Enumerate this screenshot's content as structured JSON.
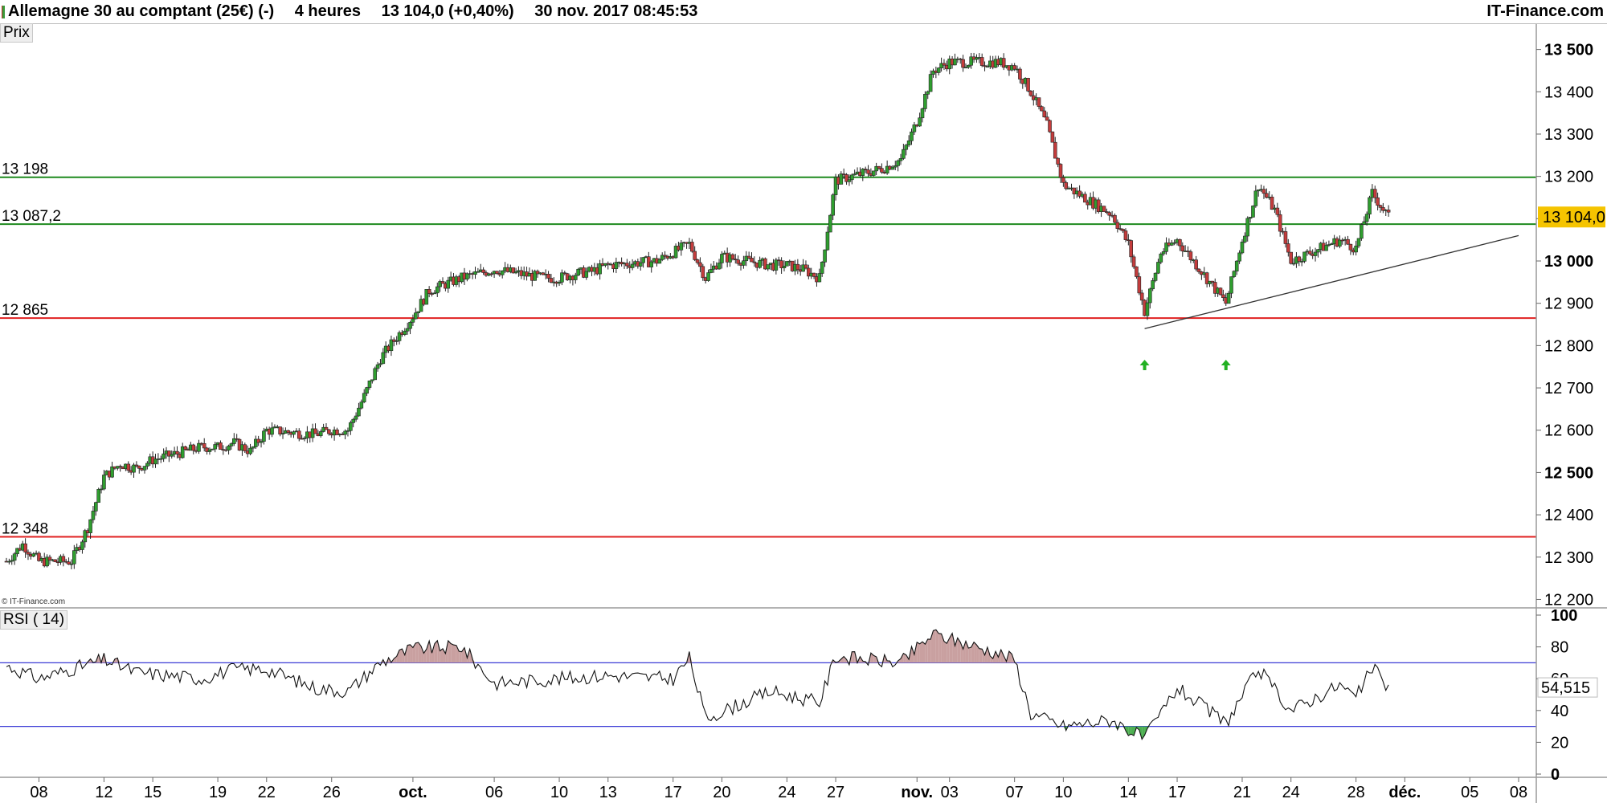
{
  "header": {
    "instrument": "Allemagne 30 au comptant (25€) (-)",
    "timeframe": "4 heures",
    "last_price_change": "13 104,0 (+0,40%)",
    "datetime": "30 nov. 2017 08:45:53",
    "brand": "IT-Finance.com"
  },
  "price_panel": {
    "label": "Prix",
    "copyright": "© IT-Finance.com"
  },
  "rsi_panel": {
    "label": "RSI ( 14)"
  },
  "colors": {
    "up_candle": "#2f9e2f",
    "down_candle": "#c43c3c",
    "resistance_line": "#1e8a1e",
    "support_line": "#e02020",
    "rsi_band": "#3b3bd6",
    "rsi_fill": "#c9a0a0",
    "price_badge": "#f5c400",
    "signal_arrow": "#22b022"
  },
  "chart_data": [
    {
      "type": "candlestick",
      "title": "Allemagne 30 au comptant (25€) (-)",
      "timeframe": "4 heures",
      "y_ticks": [
        "12 200",
        "12 300",
        "12 400",
        "12 500",
        "12 600",
        "12 700",
        "12 800",
        "12 900",
        "13 000",
        "13 100",
        "13 200",
        "13 300",
        "13 400",
        "13 500"
      ],
      "ylim": [
        12180,
        13560
      ],
      "x_tick_labels": [
        "08",
        "12",
        "15",
        "19",
        "22",
        "26",
        "oct.",
        "06",
        "10",
        "13",
        "17",
        "20",
        "24",
        "27",
        "nov.",
        "03",
        "07",
        "10",
        "14",
        "17",
        "21",
        "24",
        "28",
        "déc.",
        "05",
        "08"
      ],
      "last_price": "13 104,0",
      "horizontal_levels": [
        {
          "label": "13 198",
          "value": 13198,
          "kind": "resistance"
        },
        {
          "label": "13 087,2",
          "value": 13087.2,
          "kind": "resistance"
        },
        {
          "label": "12 865",
          "value": 12865,
          "kind": "support"
        },
        {
          "label": "12 348",
          "value": 12348,
          "kind": "support"
        }
      ],
      "trendline": {
        "from": {
          "date": "2017-11-15",
          "value": 12840
        },
        "to": {
          "date": "2017-12-08",
          "value": 13060
        }
      },
      "signal_arrows": [
        {
          "date": "2017-11-15",
          "direction": "up"
        },
        {
          "date": "2017-11-20",
          "direction": "up"
        }
      ],
      "close_path": [
        {
          "x": "2017-09-06",
          "y": 12290
        },
        {
          "x": "2017-09-07",
          "y": 12330
        },
        {
          "x": "2017-09-08",
          "y": 12290
        },
        {
          "x": "2017-09-10",
          "y": 12290
        },
        {
          "x": "2017-09-11",
          "y": 12370
        },
        {
          "x": "2017-09-12",
          "y": 12490
        },
        {
          "x": "2017-09-13",
          "y": 12520
        },
        {
          "x": "2017-09-14",
          "y": 12510
        },
        {
          "x": "2017-09-15",
          "y": 12530
        },
        {
          "x": "2017-09-18",
          "y": 12560
        },
        {
          "x": "2017-09-19",
          "y": 12560
        },
        {
          "x": "2017-09-20",
          "y": 12570
        },
        {
          "x": "2017-09-21",
          "y": 12550
        },
        {
          "x": "2017-09-22",
          "y": 12600
        },
        {
          "x": "2017-09-25",
          "y": 12590
        },
        {
          "x": "2017-09-26",
          "y": 12600
        },
        {
          "x": "2017-09-27",
          "y": 12600
        },
        {
          "x": "2017-09-28",
          "y": 12680
        },
        {
          "x": "2017-09-29",
          "y": 12770
        },
        {
          "x": "2017-10-01",
          "y": 12870
        },
        {
          "x": "2017-10-02",
          "y": 12930
        },
        {
          "x": "2017-10-04",
          "y": 12960
        },
        {
          "x": "2017-10-06",
          "y": 12980
        },
        {
          "x": "2017-10-09",
          "y": 12960
        },
        {
          "x": "2017-10-10",
          "y": 12960
        },
        {
          "x": "2017-10-11",
          "y": 12970
        },
        {
          "x": "2017-10-12",
          "y": 12975
        },
        {
          "x": "2017-10-13",
          "y": 12990
        },
        {
          "x": "2017-10-16",
          "y": 13000
        },
        {
          "x": "2017-10-17",
          "y": 13020
        },
        {
          "x": "2017-10-18",
          "y": 13040
        },
        {
          "x": "2017-10-19",
          "y": 12960
        },
        {
          "x": "2017-10-20",
          "y": 13010
        },
        {
          "x": "2017-10-23",
          "y": 12990
        },
        {
          "x": "2017-10-24",
          "y": 12990
        },
        {
          "x": "2017-10-25",
          "y": 12980
        },
        {
          "x": "2017-10-26",
          "y": 12960
        },
        {
          "x": "2017-10-27",
          "y": 13190
        },
        {
          "x": "2017-10-30",
          "y": 13220
        },
        {
          "x": "2017-10-31",
          "y": 13240
        },
        {
          "x": "2017-11-01",
          "y": 13330
        },
        {
          "x": "2017-11-02",
          "y": 13450
        },
        {
          "x": "2017-11-03",
          "y": 13470
        },
        {
          "x": "2017-11-06",
          "y": 13470
        },
        {
          "x": "2017-11-07",
          "y": 13460
        },
        {
          "x": "2017-11-08",
          "y": 13400
        },
        {
          "x": "2017-11-09",
          "y": 13320
        },
        {
          "x": "2017-11-10",
          "y": 13180
        },
        {
          "x": "2017-11-13",
          "y": 13110
        },
        {
          "x": "2017-11-14",
          "y": 13040
        },
        {
          "x": "2017-11-15",
          "y": 12880
        },
        {
          "x": "2017-11-16",
          "y": 13020
        },
        {
          "x": "2017-11-17",
          "y": 13050
        },
        {
          "x": "2017-11-20",
          "y": 12900
        },
        {
          "x": "2017-11-21",
          "y": 13050
        },
        {
          "x": "2017-11-22",
          "y": 13180
        },
        {
          "x": "2017-11-23",
          "y": 13120
        },
        {
          "x": "2017-11-24",
          "y": 13000
        },
        {
          "x": "2017-11-27",
          "y": 13050
        },
        {
          "x": "2017-11-28",
          "y": 13030
        },
        {
          "x": "2017-11-29",
          "y": 13160
        },
        {
          "x": "2017-11-30",
          "y": 13104
        }
      ]
    },
    {
      "type": "line",
      "title": "RSI ( 14)",
      "y_ticks": [
        "0",
        "20",
        "40",
        "60",
        "80",
        "100"
      ],
      "ylim": [
        0,
        100
      ],
      "bands": [
        30,
        70
      ],
      "last_value": "54,515",
      "series": [
        {
          "values_by_date": [
            {
              "x": "2017-09-06",
              "y": 68
            },
            {
              "x": "2017-09-08",
              "y": 60
            },
            {
              "x": "2017-09-12",
              "y": 72
            },
            {
              "x": "2017-09-14",
              "y": 64
            },
            {
              "x": "2017-09-18",
              "y": 60
            },
            {
              "x": "2017-09-20",
              "y": 66
            },
            {
              "x": "2017-09-22",
              "y": 66
            },
            {
              "x": "2017-09-25",
              "y": 54
            },
            {
              "x": "2017-09-27",
              "y": 52
            },
            {
              "x": "2017-09-29",
              "y": 70
            },
            {
              "x": "2017-10-01",
              "y": 79
            },
            {
              "x": "2017-10-04",
              "y": 80
            },
            {
              "x": "2017-10-06",
              "y": 57
            },
            {
              "x": "2017-10-10",
              "y": 60
            },
            {
              "x": "2017-10-13",
              "y": 62
            },
            {
              "x": "2017-10-17",
              "y": 60
            },
            {
              "x": "2017-10-18",
              "y": 73
            },
            {
              "x": "2017-10-19",
              "y": 35
            },
            {
              "x": "2017-10-23",
              "y": 52
            },
            {
              "x": "2017-10-26",
              "y": 45
            },
            {
              "x": "2017-10-27",
              "y": 74
            },
            {
              "x": "2017-10-31",
              "y": 70
            },
            {
              "x": "2017-11-02",
              "y": 88
            },
            {
              "x": "2017-11-06",
              "y": 76
            },
            {
              "x": "2017-11-07",
              "y": 72
            },
            {
              "x": "2017-11-08",
              "y": 38
            },
            {
              "x": "2017-11-10",
              "y": 30
            },
            {
              "x": "2017-11-13",
              "y": 34
            },
            {
              "x": "2017-11-15",
              "y": 22
            },
            {
              "x": "2017-11-17",
              "y": 54
            },
            {
              "x": "2017-11-20",
              "y": 32
            },
            {
              "x": "2017-11-22",
              "y": 66
            },
            {
              "x": "2017-11-24",
              "y": 40
            },
            {
              "x": "2017-11-27",
              "y": 56
            },
            {
              "x": "2017-11-28",
              "y": 48
            },
            {
              "x": "2017-11-29",
              "y": 67
            },
            {
              "x": "2017-11-30",
              "y": 54.5
            }
          ]
        }
      ]
    }
  ]
}
